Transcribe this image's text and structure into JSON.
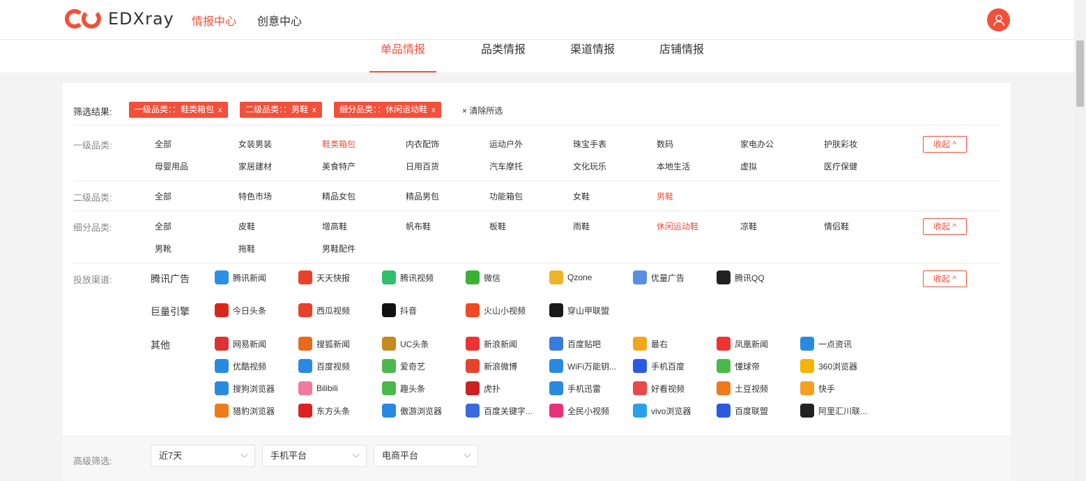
{
  "app": {
    "logo_text": "EDXray"
  },
  "topnav": {
    "items": [
      "情报中心",
      "创意中心"
    ]
  },
  "subtabs": [
    "单品情报",
    "品类情报",
    "渠道情报",
    "店铺情报"
  ],
  "filter": {
    "label": "筛选结果:",
    "chips": [
      "一级品类：：鞋类箱包",
      "二级品类：：男鞋",
      "细分品类：：休闲运动鞋"
    ],
    "chip_close": "x",
    "clear_all": "清除所选"
  },
  "level1": {
    "label": "一级品类:",
    "options": [
      "全部",
      "女装男装",
      "鞋类箱包",
      "内衣配饰",
      "运动户外",
      "珠宝手表",
      "数码",
      "家电办公",
      "护肤彩妆",
      "母婴用品",
      "家居建材",
      "美食特产",
      "日用百货",
      "汽车摩托",
      "文化玩乐",
      "本地生活",
      "虚拟",
      "医疗保健"
    ],
    "selected": "鞋类箱包",
    "collapse": "收起 ^"
  },
  "level2": {
    "label": "二级品类:",
    "options": [
      "全部",
      "特色市场",
      "精品女包",
      "精品男包",
      "功能箱包",
      "女鞋",
      "男鞋"
    ],
    "selected": "男鞋"
  },
  "level3": {
    "label": "细分品类:",
    "options": [
      "全部",
      "皮鞋",
      "增高鞋",
      "帆布鞋",
      "板鞋",
      "雨鞋",
      "休闲运动鞋",
      "凉鞋",
      "情侣鞋",
      "男靴",
      "拖鞋",
      "男鞋配件"
    ],
    "selected": "休闲运动鞋",
    "collapse": "收起 ^"
  },
  "channels": {
    "label": "投放渠道:",
    "collapse": "收起 ^",
    "groups": [
      {
        "name": "腾讯广告",
        "items": [
          "腾讯新闻",
          "天天快报",
          "腾讯视频",
          "微信",
          "Qzone",
          "优量广告",
          "腾讯QQ"
        ]
      },
      {
        "name": "巨量引擎",
        "items": [
          "今日头条",
          "西瓜视频",
          "抖音",
          "火山小视频",
          "穿山甲联盟"
        ]
      },
      {
        "name": "其他",
        "items": [
          "网易新闻",
          "搜狐新闻",
          "UC头条",
          "新浪新闻",
          "百度贴吧",
          "最右",
          "凤凰新闻",
          "一点资讯",
          "优酷视频",
          "百度视频",
          "爱奇艺",
          "新浪微博",
          "WiFi万能钥...",
          "手机百度",
          "懂球帝",
          "360浏览器",
          "搜狗浏览器",
          "Bilibili",
          "趣头条",
          "虎扑",
          "手机迅雷",
          "好看视频",
          "土豆视频",
          "快手",
          "猎豹浏览器",
          "东方头条",
          "傲游浏览器",
          "百度关键字...",
          "全民小视频",
          "vivo浏览器",
          "百度联盟",
          "阿里汇川联..."
        ]
      }
    ]
  },
  "advanced": {
    "label": "高级筛选:",
    "selects": [
      "近7天",
      "手机平台",
      "电商平台"
    ]
  },
  "colors": {
    "accent": "#f2503a"
  }
}
